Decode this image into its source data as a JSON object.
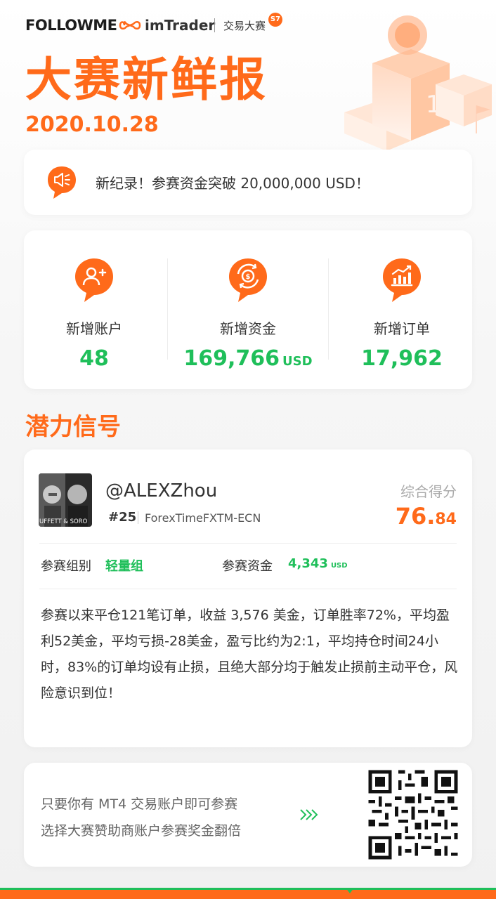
{
  "header": {
    "brand_followme": "FOLLOWME",
    "brand_imtrader": "imTrader",
    "contest_name": "交易大赛",
    "season_badge": "S7",
    "title": "大赛新鲜报",
    "date": "2020.10.28"
  },
  "news": {
    "icon": "speaker-icon",
    "text": "新纪录！参赛资金突破 20,000,000 USD！"
  },
  "stats": [
    {
      "icon": "add-user-icon",
      "label": "新增账户",
      "value": "48",
      "unit": ""
    },
    {
      "icon": "money-exchange-icon",
      "label": "新增资金",
      "value": "169,766",
      "unit": "USD"
    },
    {
      "icon": "chart-growth-icon",
      "label": "新增订单",
      "value": "17,962",
      "unit": ""
    }
  ],
  "signal_section": {
    "title": "潜力信号",
    "avatar_caption": "UFFETT & SORO",
    "username": "@ALEXZhou",
    "rank": "#25",
    "broker": "ForexTimeFXTM-ECN",
    "score_label": "综合得分",
    "score_int": "76.",
    "score_dec": "84",
    "group_label": "参赛组别",
    "group_value": "轻量组",
    "fund_label": "参赛资金",
    "fund_value": "4,343",
    "fund_unit": "USD",
    "description": "参赛以来平仓121笔订单，收益 3,576 美金，订单胜率72%，平均盈利52美金，平均亏损-28美金，盈亏比约为2:1，平均持仓时间24小时，83%的订单均设有止损，且绝大部分均于触发止损前主动平仓，风险意识到位！"
  },
  "promo": {
    "line1": "只要你有 MT4 交易账户即可参赛",
    "line2": "选择大赛赞助商账户参赛奖金翻倍"
  },
  "colors": {
    "accent": "#ff6a1a",
    "positive": "#1fbf5a"
  }
}
